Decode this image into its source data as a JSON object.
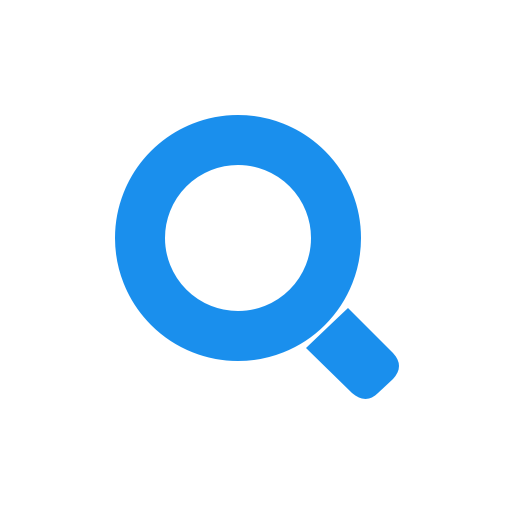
{
  "icon": {
    "name": "search-icon",
    "color": "#1A8FED",
    "background": "#FFFFFF"
  }
}
